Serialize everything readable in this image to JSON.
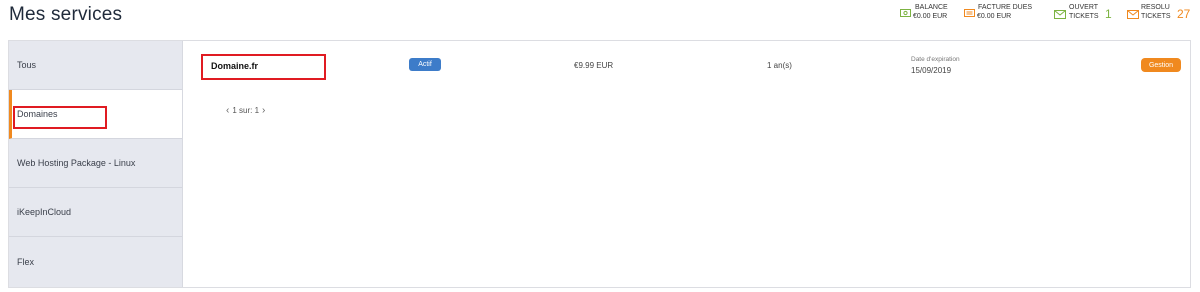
{
  "page": {
    "title": "Mes services"
  },
  "header_stats": {
    "balance": {
      "label": "BALANCE",
      "value": "€0.00 EUR",
      "color": "#7cb342"
    },
    "facture": {
      "label": "FACTURE DUES",
      "value": "€0.00 EUR",
      "color": "#f0891f"
    },
    "ouvert": {
      "label": "OUVERT",
      "sub": "TICKETS",
      "count": "1",
      "color": "#7cb342"
    },
    "resolu": {
      "label": "RESOLU",
      "sub": "TICKETS",
      "count": "27",
      "color": "#f0891f"
    }
  },
  "sidebar": {
    "items": [
      {
        "label": "Tous"
      },
      {
        "label": "Domaines",
        "active": true
      },
      {
        "label": "Web Hosting Package - Linux"
      },
      {
        "label": "iKeepInCloud"
      },
      {
        "label": "Flex"
      }
    ]
  },
  "service": {
    "name": "Domaine.fr",
    "status": "Actif",
    "price": "€9.99 EUR",
    "period": "1 an(s)",
    "expiration_label": "Date d'expiration",
    "expiration_date": "15/09/2019",
    "action": "Gestion"
  },
  "pager": {
    "text": "1 sur: 1"
  },
  "colors": {
    "accent": "#f0891f",
    "active_badge": "#3d7cc9",
    "highlight": "#e01b22"
  }
}
